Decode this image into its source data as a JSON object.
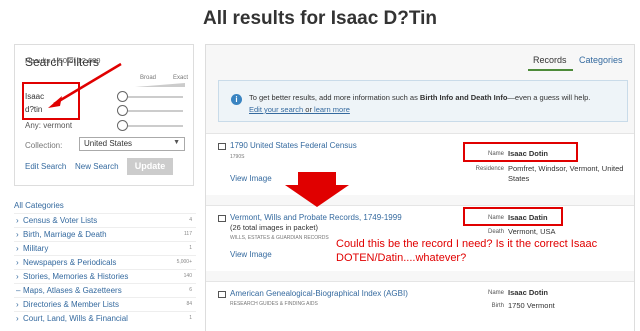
{
  "page_title": "All results for Isaac D?Tin",
  "filters": {
    "title": "Search Filters",
    "broad": "Broad",
    "exact": "Exact",
    "first_name": "Isaac",
    "last_name": "d?tin",
    "any_place": "Any: vermont",
    "collection_label": "Collection:",
    "collection_value": "United States",
    "edit_search": "Edit Search",
    "new_search": "New Search",
    "update": "Update"
  },
  "categories": {
    "heading": "All Categories",
    "items": [
      {
        "label": "Census & Voter Lists",
        "count": "4",
        "chevron": "›"
      },
      {
        "label": "Birth, Marriage & Death",
        "count": "117",
        "chevron": "›"
      },
      {
        "label": "Military",
        "count": "1",
        "chevron": "›"
      },
      {
        "label": "Newspapers & Periodicals",
        "count": "5,000+",
        "chevron": "›"
      },
      {
        "label": "Stories, Memories & Histories",
        "count": "140",
        "chevron": "›"
      },
      {
        "label": "Maps, Atlases & Gazetteers",
        "count": "6",
        "chevron": "–"
      },
      {
        "label": "Directories & Member Lists",
        "count": "84",
        "chevron": "›"
      },
      {
        "label": "Court, Land, Wills & Financial",
        "count": "1",
        "chevron": "›"
      }
    ]
  },
  "results": {
    "count_text": "Results 1-50 of 12,680",
    "tab_records": "Records",
    "tab_categories": "Categories",
    "info_text_pre": "To get better results, add more information such as ",
    "info_text_bold": "Birth Info and Death Info",
    "info_text_post": "—even a guess will help.",
    "info_edit": "Edit your search",
    "info_or": " or ",
    "info_learn": "learn more",
    "records": [
      {
        "title": "1790 United States Federal Census",
        "sub": "1790S",
        "sub2": "",
        "view_image": "View Image",
        "name_label": "Name",
        "name": "Isaac Dotin",
        "second_label": "Residence",
        "second_value": "Pomfret, Windsor, Vermont, United States"
      },
      {
        "title": "Vermont, Wills and Probate Records, 1749-1999",
        "sub2": "(26 total images in packet)",
        "sub": "WILLS, ESTATES & GUARDIAN RECORDS",
        "view_image": "View Image",
        "name_label": "Name",
        "name": "Isaac Datin",
        "second_label": "Death",
        "second_value": "Vermont, USA"
      },
      {
        "title": "American Genealogical-Biographical Index (AGBI)",
        "sub": "RESEARCH GUIDES & FINDING AIDS",
        "sub2": "",
        "view_image": "",
        "name_label": "Name",
        "name": "Isaac Dotin",
        "second_label": "Birth",
        "second_value": "1750 Vermont"
      }
    ]
  },
  "annotation": "Could this be the record I need?  Is it the correct Isaac DOTEN/Datin....whatever?",
  "colors": {
    "annotation_red": "#e00000",
    "link_blue": "#356a9f",
    "tab_green": "#4d8b3a"
  }
}
